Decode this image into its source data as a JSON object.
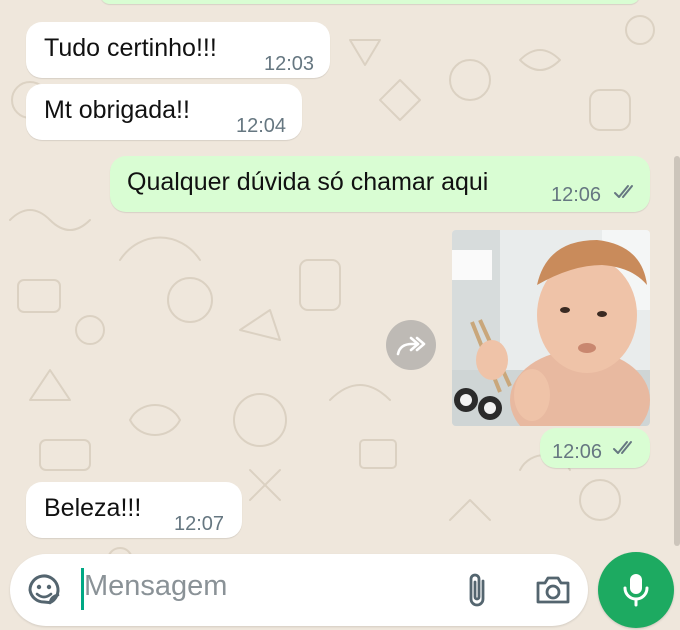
{
  "messages": [
    {
      "text": "Tudo certinho!!!",
      "time": "12:03"
    },
    {
      "text": "Mt obrigada!!",
      "time": "12:04"
    },
    {
      "text": "Qualquer dúvida só chamar aqui",
      "time": "12:06"
    },
    {
      "time": "12:06"
    },
    {
      "text": "Beleza!!!",
      "time": "12:07"
    }
  ],
  "composer": {
    "placeholder": "Mensagem"
  },
  "colors": {
    "incoming": "#ffffff",
    "outgoing": "#d9fdd3",
    "accent": "#1daa61",
    "ticks": "#667781"
  },
  "icons": [
    "sticker-icon",
    "attach-icon",
    "camera-icon",
    "mic-icon",
    "forward-icon",
    "double-check-icon"
  ]
}
